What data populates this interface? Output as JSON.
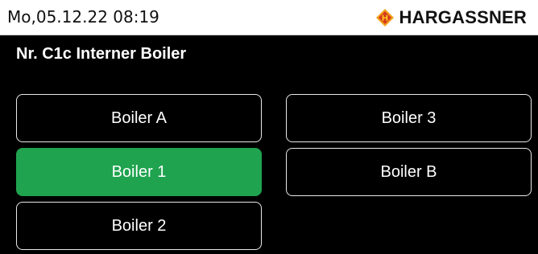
{
  "header": {
    "datetime": "Mo,05.12.22 08:19",
    "brand_name": "HARGASSNER",
    "brand_icon": "hargassner-logo-icon",
    "brand_icon_letter": "H"
  },
  "page": {
    "title": "Nr. C1c Interner Boiler"
  },
  "options": [
    {
      "label": "Boiler A",
      "selected": false
    },
    {
      "label": "Boiler 3",
      "selected": false
    },
    {
      "label": "Boiler 1",
      "selected": true
    },
    {
      "label": "Boiler B",
      "selected": false
    },
    {
      "label": "Boiler 2",
      "selected": false
    }
  ],
  "colors": {
    "selected": "#1fa34f",
    "background": "#000000",
    "header_background": "#ffffff",
    "logo_orange": "#f2a21b",
    "logo_red": "#d63a1e",
    "logo_yellow": "#ffd21a"
  }
}
